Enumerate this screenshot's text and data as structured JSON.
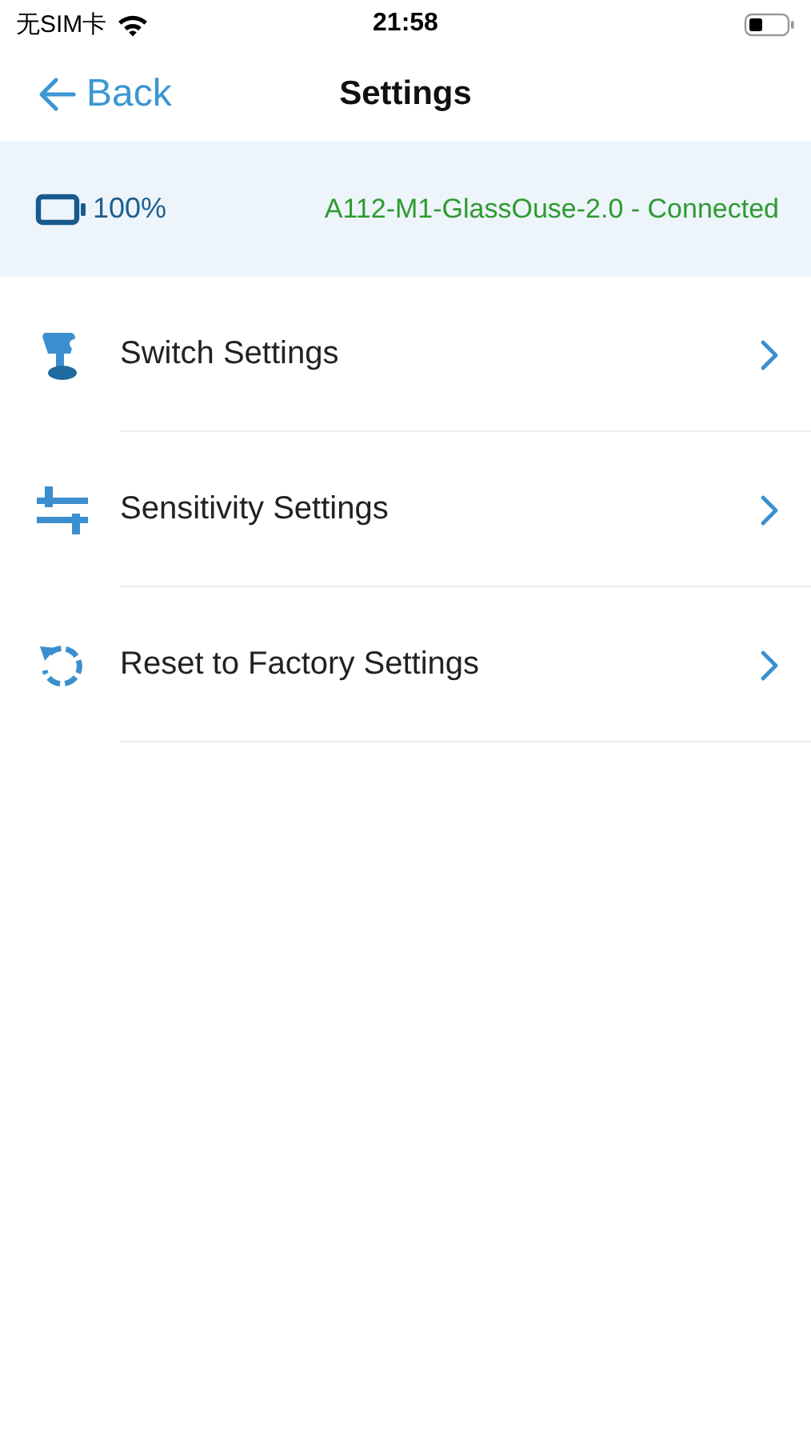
{
  "status_bar": {
    "carrier": "无SIM卡",
    "time": "21:58"
  },
  "nav": {
    "back": "Back",
    "title": "Settings"
  },
  "device": {
    "battery": "100%",
    "status": "A112-M1-GlassOuse-2.0 - Connected"
  },
  "items": [
    {
      "kind": "switch",
      "label": "Switch Settings"
    },
    {
      "kind": "sensitivity",
      "label": "Sensitivity Settings"
    },
    {
      "kind": "reset",
      "label": "Reset to Factory Settings"
    }
  ]
}
